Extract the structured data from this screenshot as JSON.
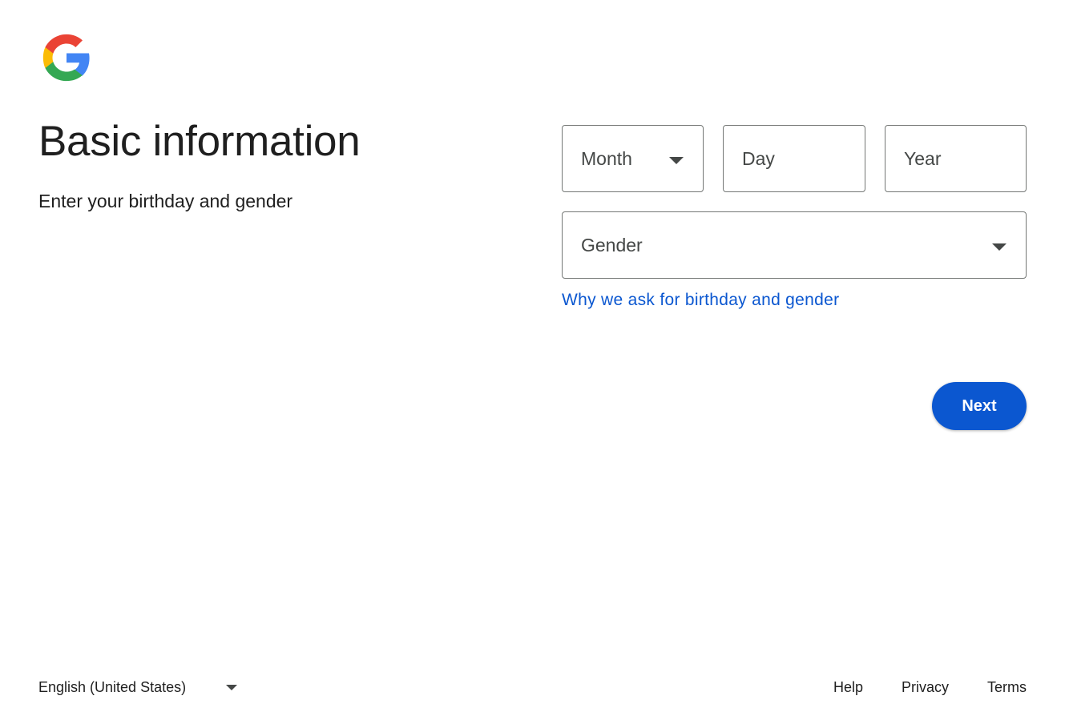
{
  "logo": {
    "icon": "google-g-logo",
    "colors": [
      "#ea4335",
      "#fbbc05",
      "#34a853",
      "#4285f4"
    ]
  },
  "header": {
    "title": "Basic information",
    "subtitle": "Enter your birthday and gender"
  },
  "birthday": {
    "month_placeholder": "Month",
    "day_placeholder": "Day",
    "year_placeholder": "Year"
  },
  "gender": {
    "placeholder": "Gender"
  },
  "links": {
    "why": "Why we ask for birthday and gender"
  },
  "actions": {
    "next_label": "Next"
  },
  "footer": {
    "language": "English (United States)",
    "help": "Help",
    "privacy": "Privacy",
    "terms": "Terms"
  },
  "colors": {
    "accent": "#0b57d0",
    "border": "#747775"
  }
}
